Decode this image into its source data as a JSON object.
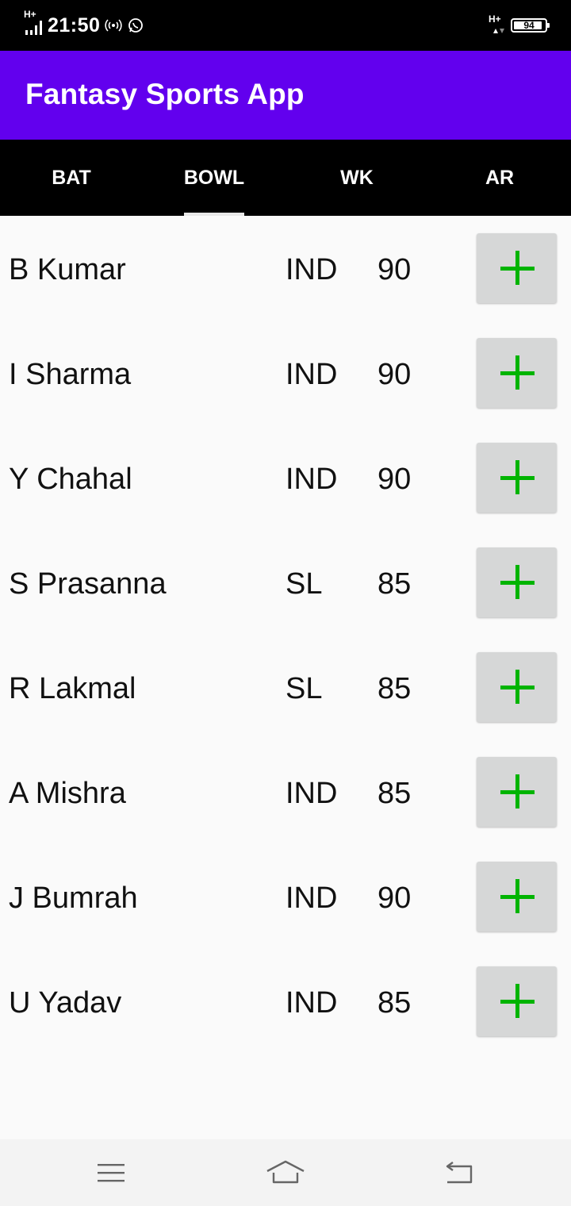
{
  "status": {
    "time": "21:50",
    "signal_left": "H+",
    "signal_right": "H+",
    "battery": "94",
    "battery_level": 94
  },
  "app": {
    "title": "Fantasy Sports App"
  },
  "tabs": [
    {
      "label": "BAT",
      "selected": false
    },
    {
      "label": "BOWL",
      "selected": true
    },
    {
      "label": "WK",
      "selected": false
    },
    {
      "label": "AR",
      "selected": false
    }
  ],
  "players": [
    {
      "name": "B Kumar",
      "team": "IND",
      "points": "90"
    },
    {
      "name": "I Sharma",
      "team": "IND",
      "points": "90"
    },
    {
      "name": "Y Chahal",
      "team": "IND",
      "points": "90"
    },
    {
      "name": "S Prasanna",
      "team": "SL",
      "points": "85"
    },
    {
      "name": "R Lakmal",
      "team": "SL",
      "points": "85"
    },
    {
      "name": "A Mishra",
      "team": "IND",
      "points": "85"
    },
    {
      "name": "J Bumrah",
      "team": "IND",
      "points": "90"
    },
    {
      "name": "U Yadav",
      "team": "IND",
      "points": "85"
    }
  ],
  "icons": {
    "add": "plus-icon",
    "nav_menu": "menu-icon",
    "nav_home": "home-icon",
    "nav_back": "back-icon"
  },
  "colors": {
    "app_bar": "#6200ee",
    "tab_bar": "#000000",
    "add_icon": "#00b400",
    "add_button": "#d6d7d7"
  }
}
